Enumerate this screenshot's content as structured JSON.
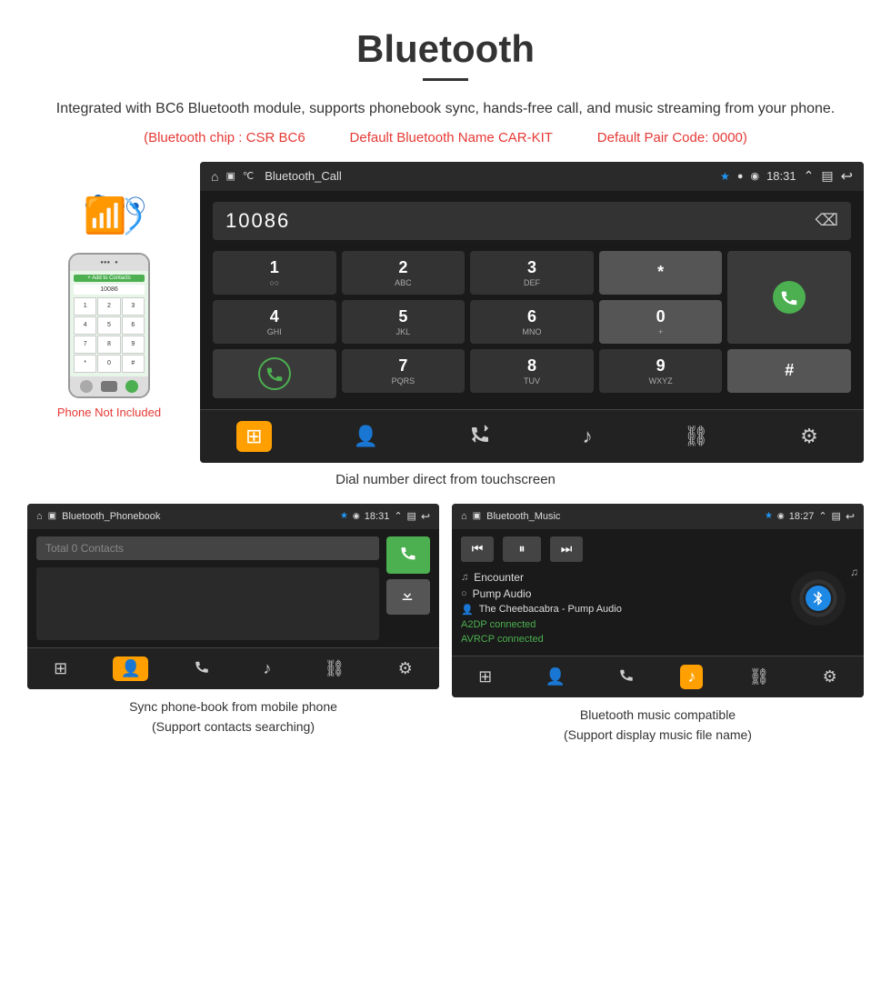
{
  "title": "Bluetooth",
  "subtitle": "Integrated with BC6 Bluetooth module, supports phonebook sync, hands-free call, and music streaming from your phone.",
  "chip_info": {
    "chip": "(Bluetooth chip : CSR BC6",
    "name": "Default Bluetooth Name CAR-KIT",
    "code": "Default Pair Code: 0000)"
  },
  "phone_not_included": "Phone Not Included",
  "dial_caption": "Dial number direct from touchscreen",
  "call_screen": {
    "title": "Bluetooth_Call",
    "time": "18:31",
    "dial_number": "10086",
    "keypad": [
      {
        "main": "1",
        "sub": "○○"
      },
      {
        "main": "2",
        "sub": "ABC"
      },
      {
        "main": "3",
        "sub": "DEF"
      },
      {
        "main": "*",
        "sub": ""
      },
      {
        "main": "call",
        "sub": ""
      },
      {
        "main": "4",
        "sub": "GHI"
      },
      {
        "main": "5",
        "sub": "JKL"
      },
      {
        "main": "6",
        "sub": "MNO"
      },
      {
        "main": "0",
        "sub": "+"
      },
      {
        "main": "recall",
        "sub": ""
      },
      {
        "main": "7",
        "sub": "PQRS"
      },
      {
        "main": "8",
        "sub": "TUV"
      },
      {
        "main": "9",
        "sub": "WXYZ"
      },
      {
        "main": "#",
        "sub": ""
      }
    ],
    "nav_icons": [
      "grid",
      "person",
      "phone-transfer",
      "music-note",
      "link",
      "settings"
    ]
  },
  "phonebook_screen": {
    "title": "Bluetooth_Phonebook",
    "time": "18:31",
    "search_placeholder": "Total 0 Contacts",
    "actions": [
      "📞",
      "⬇"
    ]
  },
  "music_screen": {
    "title": "Bluetooth_Music",
    "time": "18:27",
    "track": "Encounter",
    "album": "Pump Audio",
    "artist": "The Cheebacabra - Pump Audio",
    "status1": "A2DP connected",
    "status2": "AVRCP connected"
  },
  "captions": {
    "phonebook": "Sync phone-book from mobile phone\n(Support contacts searching)",
    "music": "Bluetooth music compatible\n(Support display music file name)"
  }
}
